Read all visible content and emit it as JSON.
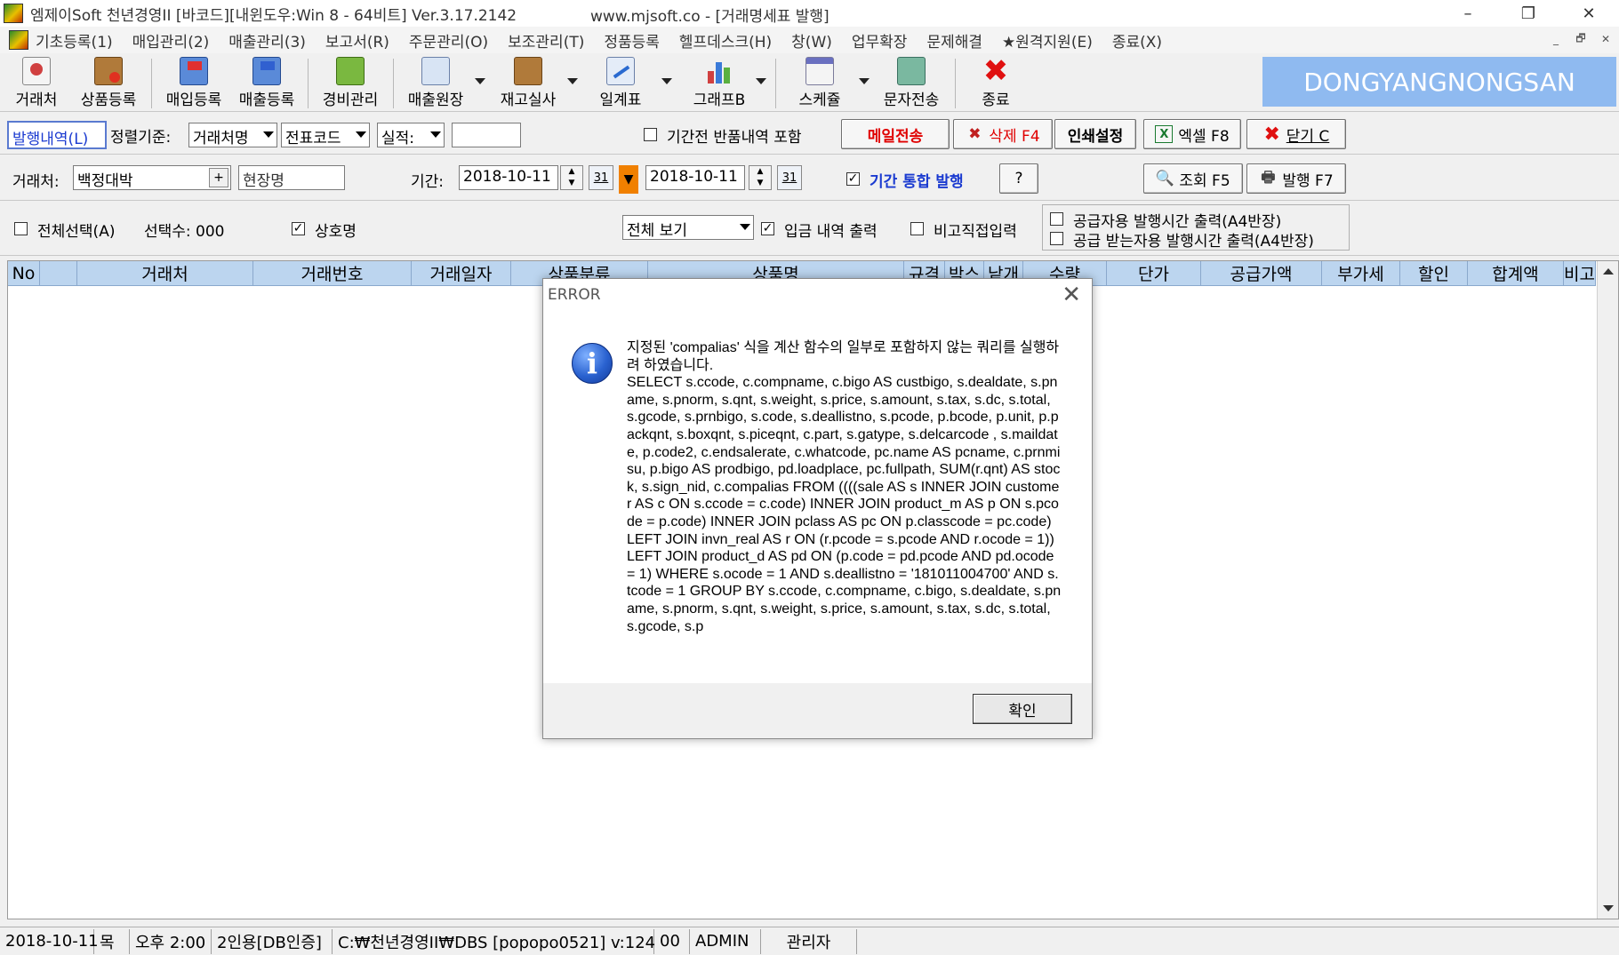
{
  "window": {
    "title": "엠제이Soft 천년경영II [바코드][내윈도우:Win 8 - 64비트] Ver.3.17.2142",
    "title_url": "www.mjsoft.co - [거래명세표 발행]",
    "min": "–",
    "max": "❐",
    "close": "✕"
  },
  "menu": {
    "items": [
      "기초등록(1)",
      "매입관리(2)",
      "매출관리(3)",
      "보고서(R)",
      "주문관리(O)",
      "보조관리(T)",
      "정품등록",
      "헬프데스크(H)",
      "창(W)",
      "업무확장",
      "문제해결",
      "★원격지원(E)",
      "종료(X)"
    ],
    "mdi_min": "_",
    "mdi_restore": "🗗",
    "mdi_close": "✕"
  },
  "toolbar": {
    "buttons": [
      "거래처",
      "상품등록",
      "매입등록",
      "매출등록",
      "경비관리",
      "매출원장",
      "재고실사",
      "일계표",
      "그래프B",
      "스케쥴",
      "문자전송",
      "종료"
    ],
    "brand": "DONGYANGNONGSAN"
  },
  "filter1": {
    "tab": "발행내역(L)",
    "sort_label": "정렬기준:",
    "sort1": "거래처명",
    "sort2": "전표코드",
    "perf": "실적:",
    "perf_value": "",
    "include_returns": "기간전 반품내역 포함",
    "btn_mail": "메일전송",
    "btn_delete": "삭제 F4",
    "btn_print_setup": "인쇄설정",
    "btn_excel": "엑셀 F8",
    "btn_close": "닫기 C"
  },
  "filter2": {
    "customer_label": "거래처:",
    "customer_value": "백정대박",
    "site_value": "현장명",
    "period_label": "기간:",
    "date_from": "2018-10-11",
    "date_to": "2018-10-11",
    "cal": "31",
    "combined_issue": "기간 통합 발행",
    "help": "?",
    "btn_search": "조회 F5",
    "btn_issue": "발행 F7"
  },
  "filter3": {
    "select_all": "전체선택(A)",
    "select_count": "선택수: 000",
    "company_name": "상호명",
    "view": "전체 보기",
    "payment_print": "입금 내역 출력",
    "remark_input": "비고직접입력",
    "supplier_time": "공급자용 발행시간 출력(A4반장)",
    "receiver_time": "공급 받는자용 발행시간 출력(A4반장)"
  },
  "grid": {
    "columns": [
      "No",
      "",
      "거래처",
      "거래번호",
      "거래일자",
      "상품분류",
      "상품명",
      "규격",
      "박스",
      "낱개",
      "수량",
      "단가",
      "공급가액",
      "부가세",
      "할인",
      "합계액",
      "비고"
    ]
  },
  "dialog": {
    "title": "ERROR",
    "close": "✕",
    "icon_glyph": "i",
    "message": "지정된 'compalias' 식을 계산 함수의 일부로 포함하지 않는 쿼리를 실행하려 하였습니다.\nSELECT s.ccode, c.compname, c.bigo AS custbigo, s.dealdate, s.pname, s.pnorm, s.qnt, s.weight, s.price, s.amount, s.tax, s.dc, s.total, s.gcode, s.prnbigo, s.code, s.deallistno, s.pcode, p.bcode, p.unit, p.packqnt, s.boxqnt, s.piceqnt, c.part, s.gatype, s.delcarcode , s.maildate, p.code2, c.endsalerate, c.whatcode, pc.name AS pcname, c.prnmisu, p.bigo AS prodbigo, pd.loadplace, pc.fullpath, SUM(r.qnt) AS stock, s.sign_nid, c.compalias FROM ((((sale AS s INNER JOIN customer AS c ON s.ccode = c.code) INNER JOIN product_m AS p ON s.pcode = p.code) INNER JOIN pclass AS pc ON p.classcode = pc.code) LEFT JOIN invn_real AS r ON (r.pcode = s.pcode AND r.ocode = 1)) LEFT JOIN product_d AS pd ON (p.code = pd.pcode AND pd.ocode = 1) WHERE s.ocode = 1 AND s.deallistno = '181011004700' AND s.tcode = 1 GROUP BY s.ccode, c.compname, c.bigo, s.dealdate, s.pname, s.pnorm, s.qnt, s.weight, s.price, s.amount, s.tax, s.dc, s.total, s.gcode, s.p",
    "ok": "확인"
  },
  "statusbar": {
    "date": "2018-10-11",
    "weekday": "목",
    "time": "오후 2:00",
    "license": "2인용[DB인증]",
    "path": "C:₩천년경영II₩DBS [popopo0521] v:124",
    "code": "00",
    "user": "ADMIN",
    "role": "관리자"
  },
  "colors": {
    "brand_bg": "#8fbaf0",
    "grid_header": "#bcd5ef",
    "mail_red": "#e00000",
    "combined_blue": "#1a3ad0"
  }
}
